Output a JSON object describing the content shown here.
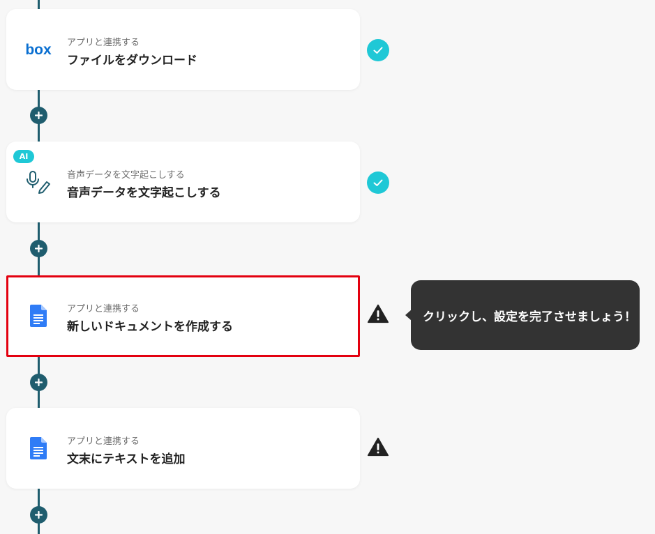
{
  "colors": {
    "flow_line": "#1f5d6e",
    "success": "#1fc8d6",
    "warning": "#222222",
    "selected_border": "#e3000f",
    "tooltip_bg": "#333333"
  },
  "steps": [
    {
      "subtitle": "アプリと連携する",
      "title": "ファイルをダウンロード",
      "icon": "box-logo",
      "icon_text": "box",
      "status": "completed"
    },
    {
      "badge": "AI",
      "subtitle": "音声データを文字起こしする",
      "title": "音声データを文字起こしする",
      "icon": "mic-pen-icon",
      "status": "completed"
    },
    {
      "subtitle": "アプリと連携する",
      "title": "新しいドキュメントを作成する",
      "icon": "google-docs-icon",
      "status": "warning",
      "selected": true
    },
    {
      "subtitle": "アプリと連携する",
      "title": "文末にテキストを追加",
      "icon": "google-docs-icon",
      "status": "warning"
    }
  ],
  "tooltip": {
    "text": "クリックし、設定を完了させましょう！"
  }
}
